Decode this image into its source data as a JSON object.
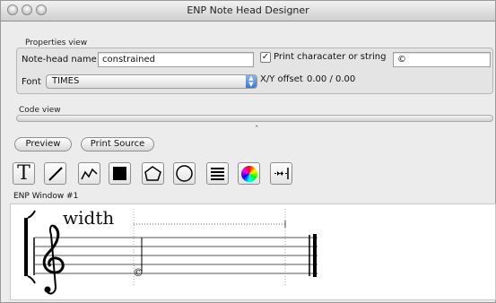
{
  "window": {
    "title": "ENP Note Head Designer"
  },
  "properties": {
    "group_label": "Properties view",
    "notehead_label": "Note-head name",
    "notehead_value": "constrained",
    "print_checkbox_label": "Print characater or string",
    "print_checked": true,
    "print_value": "©",
    "font_label": "Font",
    "font_value": "TIMES",
    "offset_label": "X/Y offset",
    "offset_value": "0.00 / 0.00"
  },
  "code_view": {
    "label": "Code view"
  },
  "buttons": {
    "preview": "Preview",
    "print_source": "Print Source"
  },
  "tools": [
    "text-tool",
    "line-tool",
    "polyline-tool",
    "filled-rect-tool",
    "polygon-tool",
    "circle-tool",
    "lines-tool",
    "color-tool",
    "spacing-tool"
  ],
  "tool_text_glyph": "T",
  "enp": {
    "window_label": "ENP Window #1",
    "annotation": "width",
    "notehead_glyph": "©"
  }
}
